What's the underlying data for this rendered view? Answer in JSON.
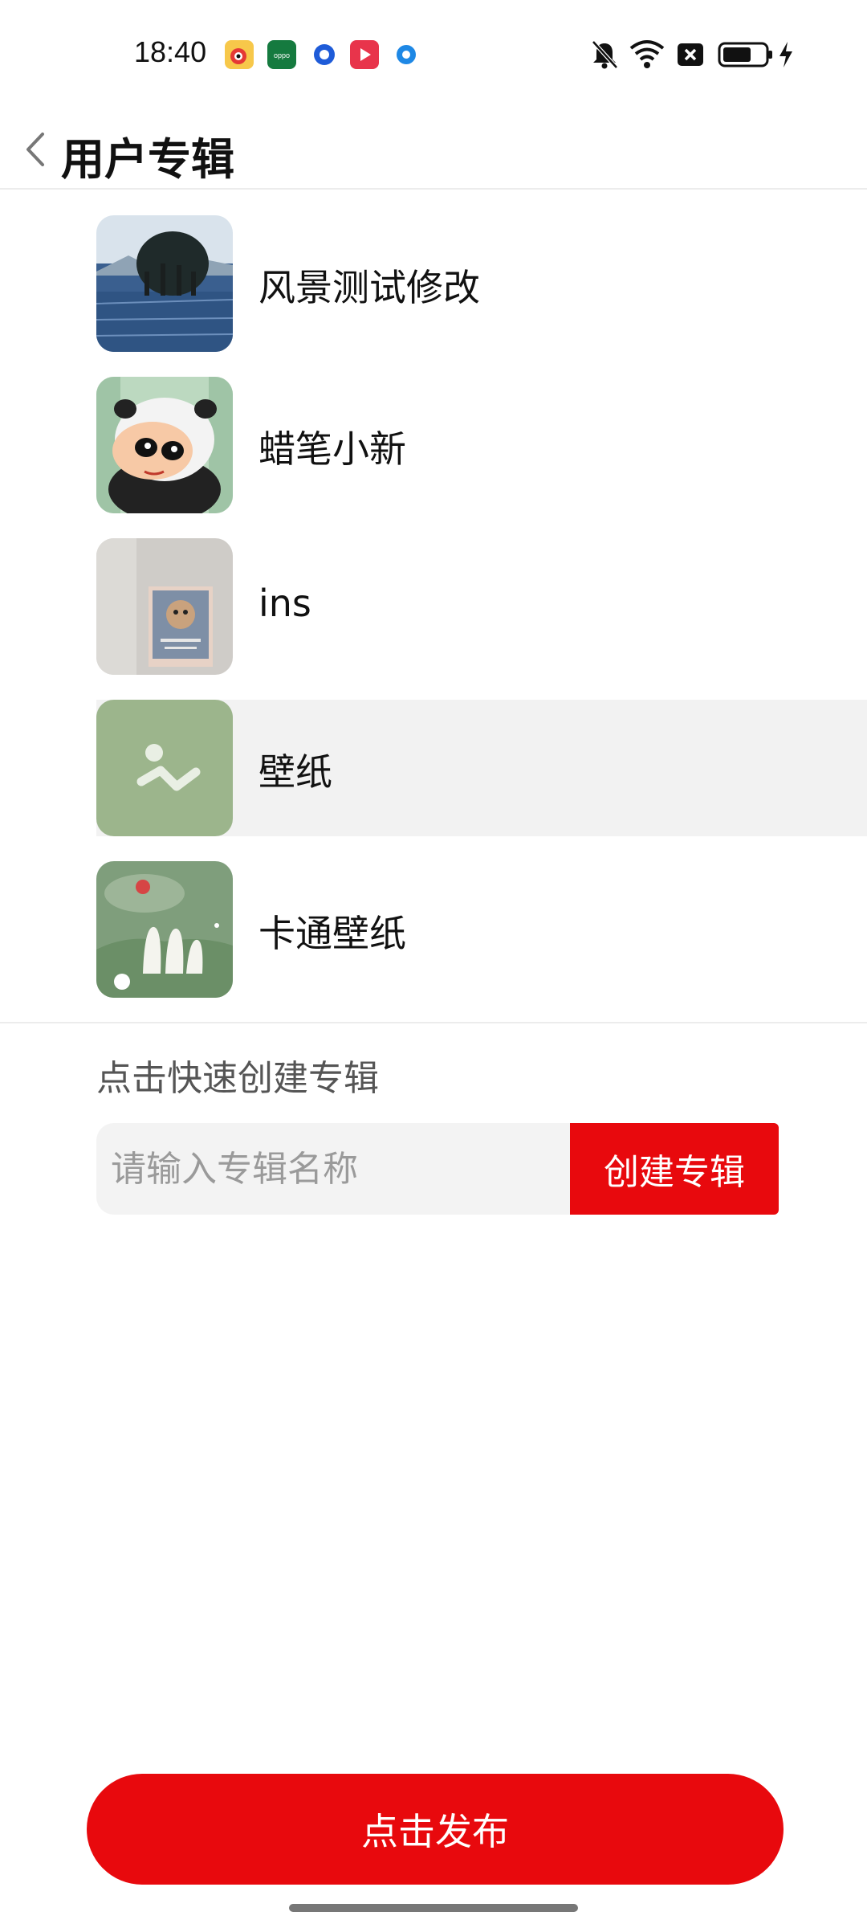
{
  "status_bar": {
    "time": "18:40",
    "notification_icons": [
      "weibo-icon",
      "oppo-icon",
      "blue-circle-app-icon",
      "video-play-icon",
      "blue-dot-app-icon"
    ],
    "system_icons": [
      "mute-icon",
      "wifi-icon",
      "x-box-icon",
      "battery-icon",
      "charging-icon"
    ]
  },
  "header": {
    "title": "用户专辑",
    "back_icon": "chevron-left-icon"
  },
  "albums": [
    {
      "label": "风景测试修改",
      "thumbnail": "landscape-trees-water"
    },
    {
      "label": "蜡笔小新",
      "thumbnail": "cartoon-crayon-shinchan"
    },
    {
      "label": "ins",
      "thumbnail": "photo-card-on-wall"
    },
    {
      "label": "壁纸",
      "thumbnail": "image-placeholder-icon",
      "selected": true
    },
    {
      "label": "卡通壁纸",
      "thumbnail": "cartoon-rabbit-green"
    }
  ],
  "quick_create": {
    "title": "点击快速创建专辑",
    "input_placeholder": "请输入专辑名称",
    "input_value": "",
    "button_label": "创建专辑"
  },
  "publish": {
    "button_label": "点击发布"
  },
  "colors": {
    "accent_red": "#e8090d",
    "selected_row_bg": "#f2f2f2",
    "placeholder_thumb_bg": "#9cb58c"
  }
}
